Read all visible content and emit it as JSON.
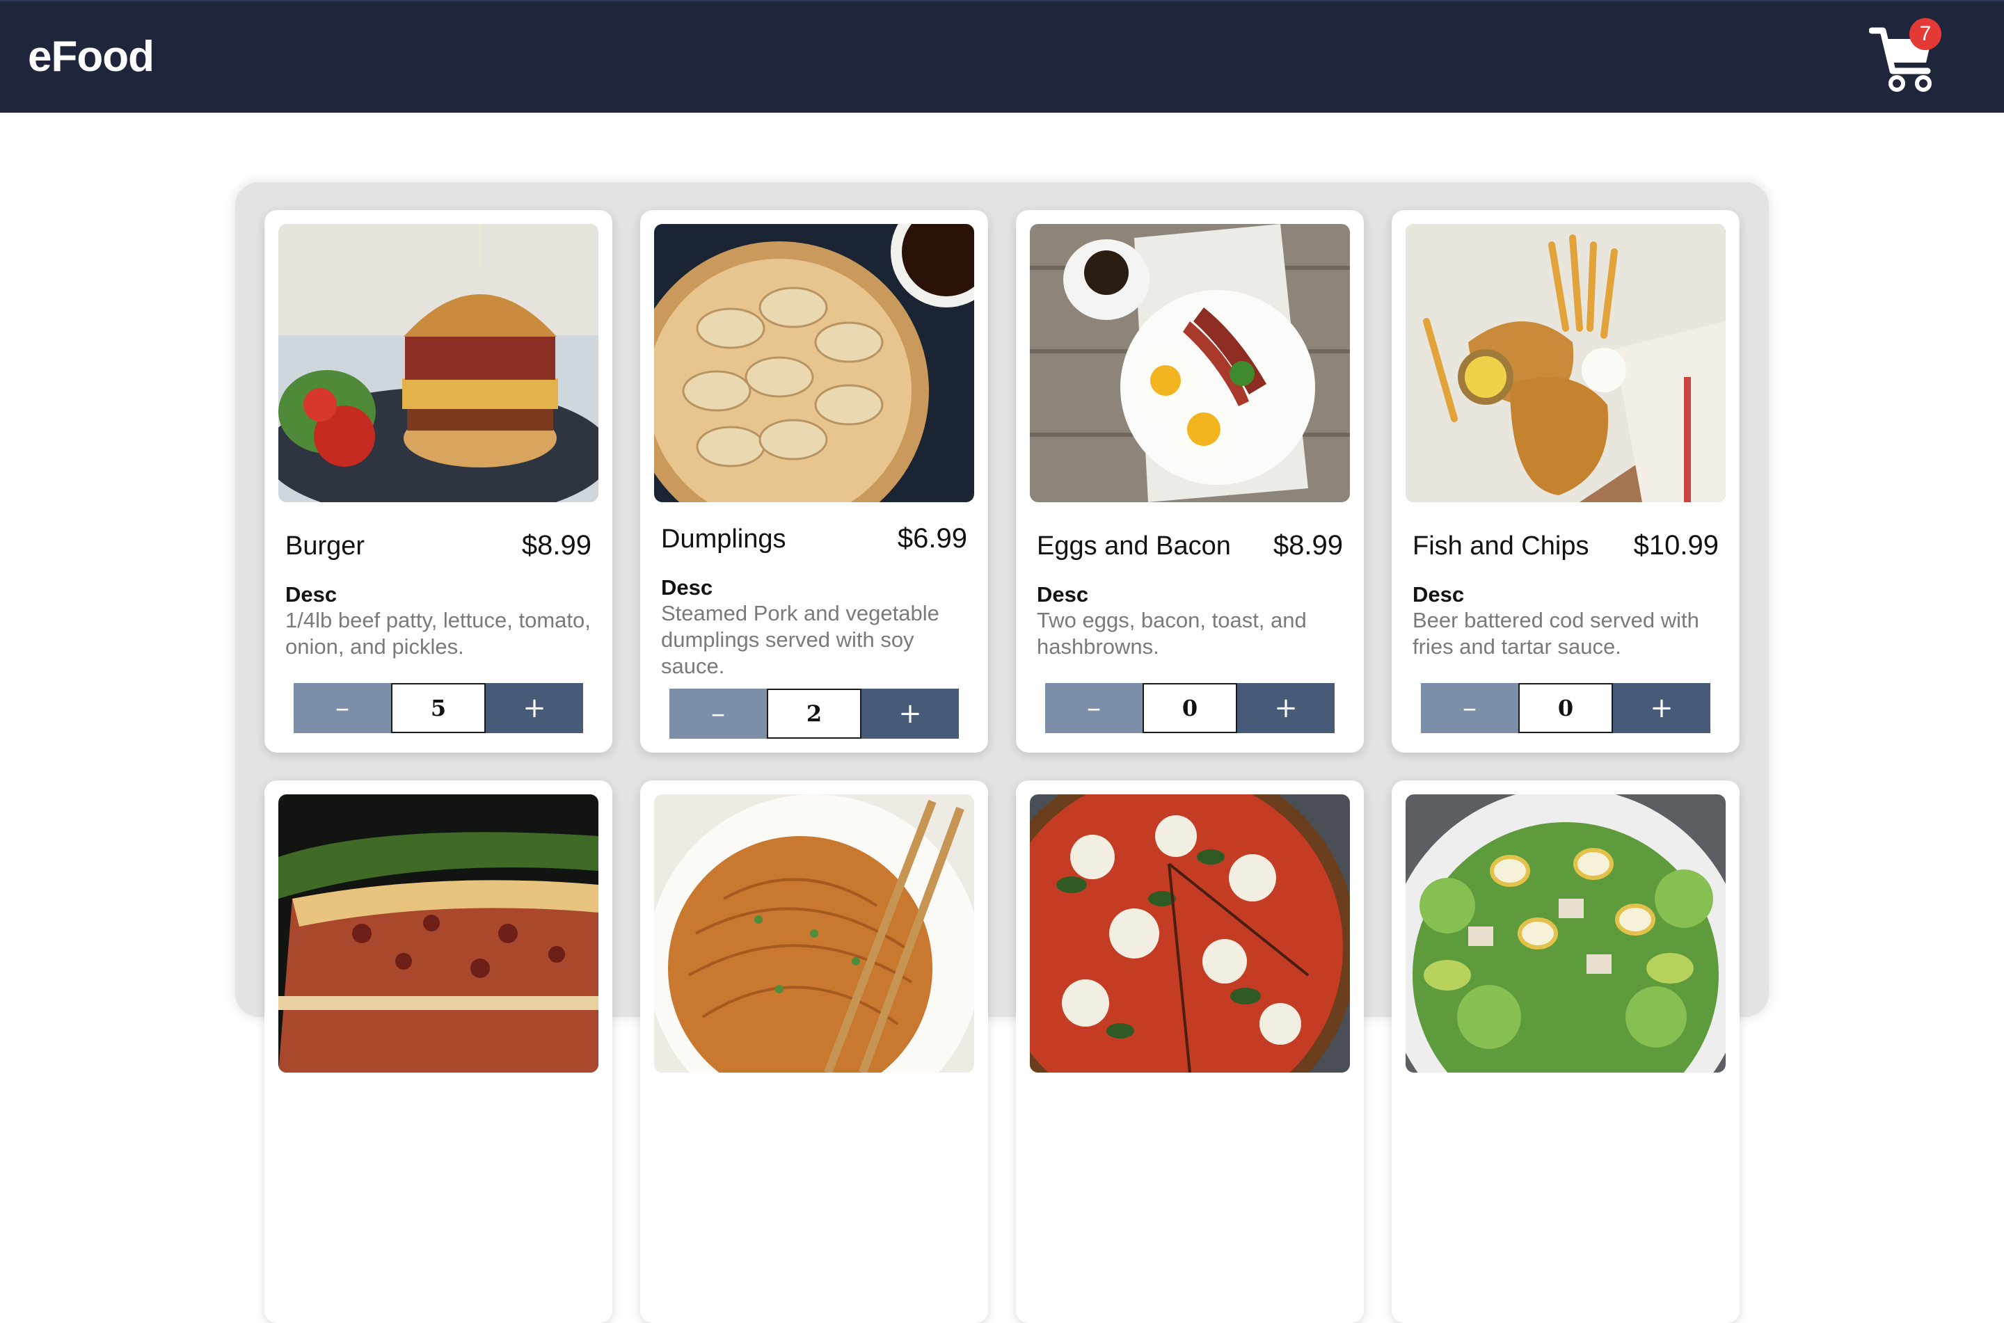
{
  "brand": "eFood",
  "cart": {
    "icon": "shopping-cart-icon",
    "count": "7"
  },
  "colors": {
    "navbar": "#1f263b",
    "minus_button": "#7d8ea9",
    "plus_button": "#475a78",
    "badge": "#e53935",
    "description": "#7a7a7a"
  },
  "menu": {
    "items": [
      {
        "name": "Burger",
        "price": "$8.99",
        "desc_label": "Desc",
        "description": "1/4lb beef patty, lettuce, tomato, onion, and pickles.",
        "quantity": "5",
        "minus": "–",
        "plus": "+"
      },
      {
        "name": "Dumplings",
        "price": "$6.99",
        "desc_label": "Desc",
        "description": "Steamed Pork and vegetable dumplings served with soy sauce.",
        "quantity": "2",
        "minus": "–",
        "plus": "+"
      },
      {
        "name": "Eggs and Bacon",
        "price": "$8.99",
        "desc_label": "Desc",
        "description": "Two eggs, bacon, toast, and hashbrowns.",
        "quantity": "0",
        "minus": "–",
        "plus": "+"
      },
      {
        "name": "Fish and Chips",
        "price": "$10.99",
        "desc_label": "Desc",
        "description": "Beer battered cod served with fries and tartar sauce.",
        "quantity": "0",
        "minus": "–",
        "plus": "+"
      }
    ]
  }
}
